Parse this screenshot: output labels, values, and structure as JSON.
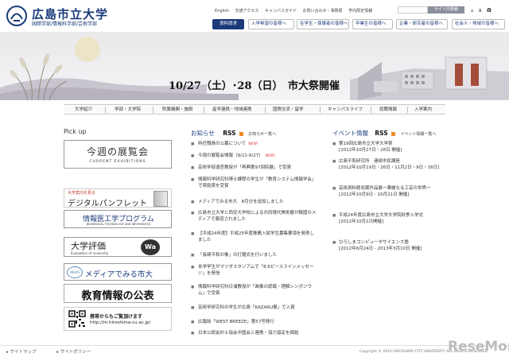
{
  "header": {
    "title": "広島市立大学",
    "subtitle": "国際学部/情報科学部/芸術学部",
    "util_links": [
      "English",
      "交通アクセス",
      "キャンパスガイド",
      "お問い合わせ・事務局",
      "学内限定情報"
    ],
    "search_button": "サイト内検索",
    "font_sizes": [
      "a",
      "a",
      "a"
    ]
  },
  "nav": {
    "tabs": [
      "資料請求",
      "入学希望の皆様へ",
      "在学生・保護者の皆様へ",
      "卒業生の皆様へ",
      "企業・研究者の皆様へ",
      "社会人・地域の皆様へ"
    ]
  },
  "banner": {
    "headline": "10/27（土）･28（日）　市大祭開催"
  },
  "mainnav": {
    "items": [
      "大学紹介",
      "学部・大学院",
      "附属機関・施設",
      "産学連携・地域連携",
      "国際交流・留学",
      "キャンパスライフ",
      "就職情報",
      "入学案内"
    ]
  },
  "pickup": {
    "heading": "Pick up",
    "banners": [
      {
        "title": "今週の展覧会",
        "sub": "CURRENT EXHIBITIONS"
      },
      {
        "title": "デジタルパンフレット",
        "sub": "大学案内を見る"
      },
      {
        "title": "情報医工学プログラム",
        "sub": "BIOMEDICAL TECHNOLOGY AND INFORMATICS"
      },
      {
        "title": "大学評価",
        "sub": "Evaluation of university"
      },
      {
        "title": "メディアでみる市大",
        "sub": "NEWS"
      },
      {
        "title": "教育情報の公表",
        "sub": ""
      },
      {
        "title": "携帯からもご覧頂けます",
        "sub": "http://m.hiroshima-cu.ac.jp/"
      }
    ]
  },
  "news": {
    "heading": "お知らせ",
    "rss": "RSS",
    "archive": "お知らせ一覧へ",
    "new_label": "NEW!",
    "items": [
      {
        "text": "特任職員の公募について",
        "new": true
      },
      {
        "text": "今週の展覧会情報（9/21-9/27）",
        "new": true
      },
      {
        "text": "芸術学部退官教授が「再興第97回院展」で受賞",
        "new": false
      },
      {
        "text": "情報科学研究科博士課程の学生が「教育システム情報学会」で奨励賞を受賞",
        "new": false
      },
      {
        "text": "メディアでみる市大　8月分を追加しました",
        "new": false
      },
      {
        "text": "広島市立大学と西安大学校による共同現代美術展が韓国のメディアで報道されました",
        "new": false
      },
      {
        "text": "【平成24年度】平成25年度推薦入試学生募集要項を発表しました",
        "new": false
      },
      {
        "text": "「長崎平和の像」の打鐘式を行いました",
        "new": false
      },
      {
        "text": "本学学生がマツダスタジアムで「8.6ピースラインメッセージ」を発信",
        "new": false
      },
      {
        "text": "情報科学研究科日浦教授が「画像の認識・理解シンポジウム」で受賞",
        "new": false
      },
      {
        "text": "芸術学研究科の学生が広島「KAZARU展」で入賞",
        "new": false
      },
      {
        "text": "広報誌「WEST BREEZE」第57号発行",
        "new": false
      },
      {
        "text": "日本公認会計士協会中国会と連携・協力協定を締結",
        "new": false
      }
    ]
  },
  "events": {
    "heading": "イベント情報",
    "rss": "RSS",
    "archive": "イベント情報一覧へ",
    "items": [
      {
        "text": "第19回広島市立大学大学祭",
        "date": "[2012年10月27日・28日 開催]"
      },
      {
        "text": "広島平和研究所　連続市民講座",
        "date": "[2012年10月19日・26日・11月2日・9日・16日]"
      },
      {
        "text": "芸術資料館収蔵作品展ー華麗なる工芸の世界ー",
        "date": "[2012年10月9日 - 10月21日 開催]"
      },
      {
        "text": "平成24年度広島市立大学大学院秋季入学式",
        "date": "[2012年10月1日開催]"
      },
      {
        "text": "ひろしまコンピュータサイエンス塾",
        "date": "[2012年6月24日 - 2013年3月10日 開催]"
      }
    ]
  },
  "footer": {
    "links": [
      "サイトマップ",
      "サイトポリシー"
    ],
    "copyright": "Copyright © 2010 HIROSHIMA CITY UNIVERSITY ALL RIGHTS RESERVED",
    "watermark": "ReseMom"
  }
}
